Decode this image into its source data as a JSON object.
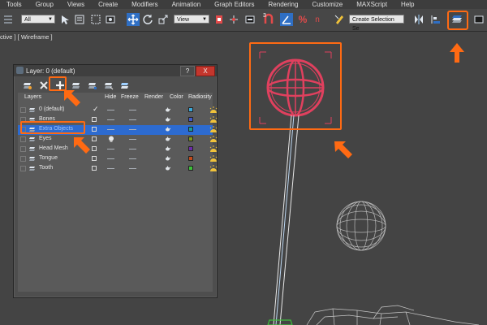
{
  "menu": [
    "Tools",
    "Group",
    "Views",
    "Create",
    "Modifiers",
    "Animation",
    "Graph Editors",
    "Rendering",
    "Customize",
    "MAXScript",
    "Help"
  ],
  "toolbar": {
    "filter_value": "All",
    "view_value": "View",
    "selection_set_value": "Create Selection Se",
    "snap_label": "3",
    "angle_label": "%",
    "percent_label": "n"
  },
  "viewport": {
    "label": "ctive ] [ Wireframe ]"
  },
  "layer_window": {
    "title": "Layer: 0 (default)",
    "help_label": "?",
    "close_label": "X",
    "columns": {
      "layers": "Layers",
      "hide": "Hide",
      "freeze": "Freeze",
      "render": "Render",
      "color": "Color",
      "radiosity": "Radiosity"
    },
    "rows": [
      {
        "name": "0 (default)",
        "active": true,
        "color": "#3aa7d8"
      },
      {
        "name": "Bones",
        "active": false,
        "color": "#3f59c8"
      },
      {
        "name": "Extra Objects",
        "active": false,
        "color": "#1e9c97"
      },
      {
        "name": "Eyes",
        "active": false,
        "color": "#7c9a1a"
      },
      {
        "name": "Head Mesh",
        "active": false,
        "color": "#6b2ca8"
      },
      {
        "name": "Tongue",
        "active": false,
        "color": "#c24a1a"
      },
      {
        "name": "Tooth",
        "active": false,
        "color": "#3dbf3a"
      }
    ],
    "selected_row": "Extra Objects",
    "checkmark": "✓"
  },
  "colors": {
    "highlight": "#ff6a13",
    "gizmo": "#e0405e",
    "wire": "#c8c8c8",
    "background": "#444444"
  }
}
